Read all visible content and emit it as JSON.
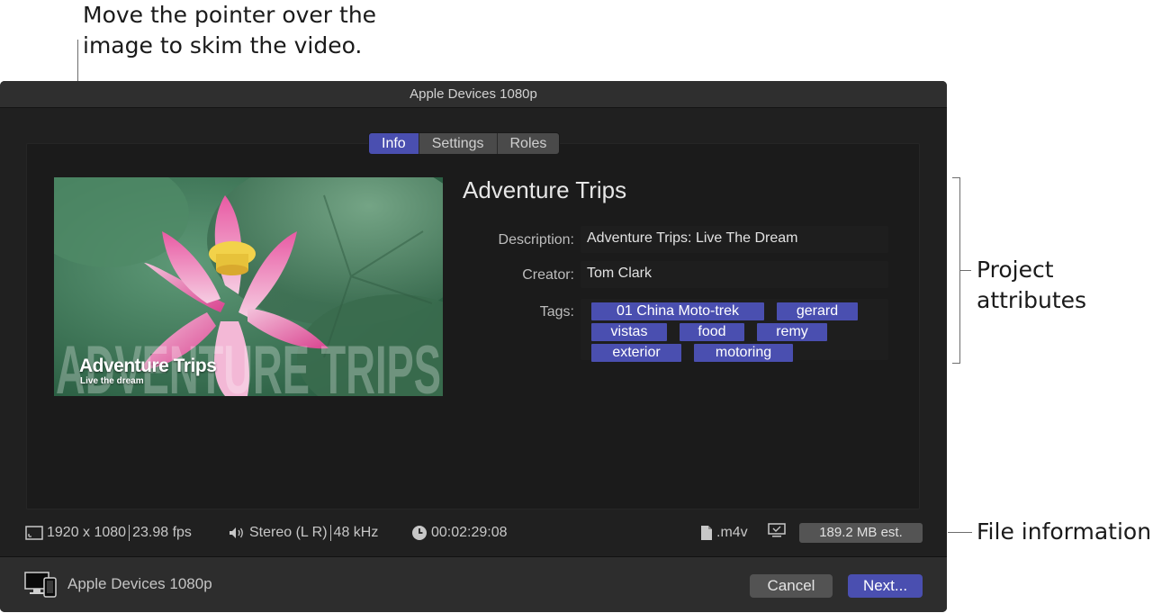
{
  "callouts": {
    "skim_line1": "Move the pointer over the",
    "skim_line2": "image to skim the video.",
    "project_line1": "Project",
    "project_line2": "attributes",
    "file": "File information"
  },
  "window": {
    "title": "Apple Devices 1080p"
  },
  "tabs": [
    {
      "label": "Info",
      "active": true
    },
    {
      "label": "Settings",
      "active": false
    },
    {
      "label": "Roles",
      "active": false
    }
  ],
  "thumbnail": {
    "watermark": "ADVENTURE TRIPS",
    "title": "Adventure Trips",
    "subtitle": "Live the dream"
  },
  "project": {
    "title": "Adventure Trips",
    "description_label": "Description:",
    "description": "Adventure Trips: Live The Dream",
    "creator_label": "Creator:",
    "creator": "Tom Clark",
    "tags_label": "Tags:",
    "tag_rows": [
      [
        "01 China Moto-trek",
        "gerard"
      ],
      [
        "vistas",
        "food",
        "remy"
      ],
      [
        "exterior",
        "motoring"
      ]
    ]
  },
  "file_info": {
    "resolution": "1920 x 1080",
    "frame_rate": "23.98 fps",
    "audio_channels": "Stereo (L R)",
    "sample_rate": "48 kHz",
    "duration": "00:02:29:08",
    "extension": ".m4v",
    "size": "189.2 MB est."
  },
  "footer": {
    "destination": "Apple Devices 1080p",
    "cancel": "Cancel",
    "next": "Next..."
  },
  "colors": {
    "accent": "#4a4fb0",
    "window_bg": "#202020",
    "footer_bg": "#2d2d2d"
  },
  "icons": [
    "frame-size-icon",
    "speaker-icon",
    "clock-icon",
    "file-icon",
    "display-icon",
    "devices-icon"
  ]
}
